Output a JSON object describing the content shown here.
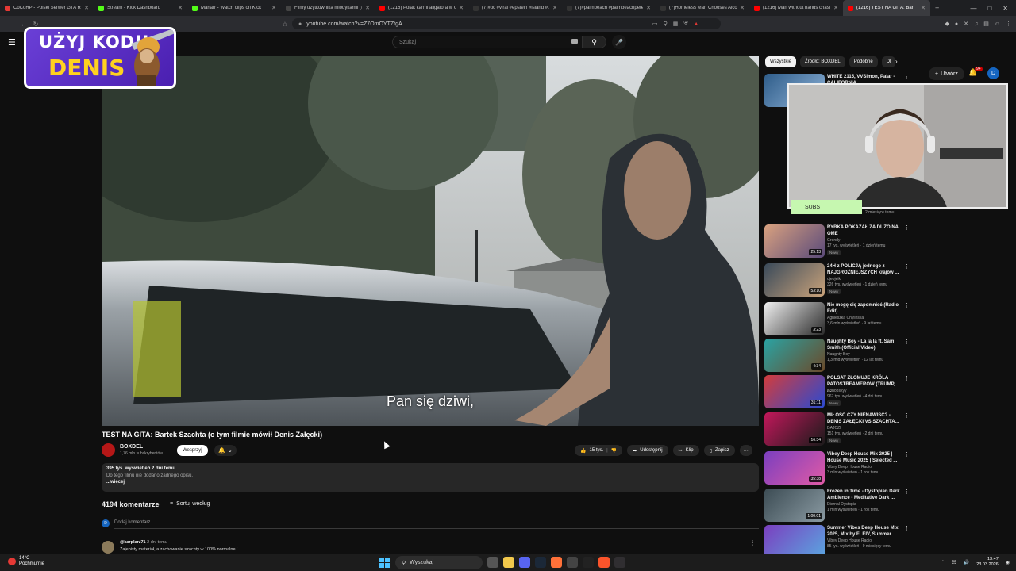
{
  "browser": {
    "tabs": [
      {
        "label": "CoCoRP - Polski Serwer GTA RP W",
        "color": "#e53935"
      },
      {
        "label": "Stream - Kick Dashboard",
        "color": "#53fc18"
      },
      {
        "label": "Maharr - Watch clips on Kick",
        "color": "#53fc18"
      },
      {
        "label": "Filmy użytkownika mlodykamil (@",
        "color": "#444444"
      },
      {
        "label": "(1216) Polak karmi aligatora w USA",
        "color": "#ff0000"
      },
      {
        "label": "(7)#dc #viral #epstein #island #tre",
        "color": "#333333"
      },
      {
        "label": "(7)#palmbeach #palmbeachpete #",
        "color": "#333333"
      },
      {
        "label": "(7)Homeless Man Chooses Alcoh",
        "color": "#333333"
      },
      {
        "label": "(1216) Man without hands chasing",
        "color": "#ff0000"
      },
      {
        "label": "(1216) TEST NA GITA: Bart",
        "color": "#ff0000"
      }
    ],
    "url": "youtube.com/watch?v=Z7OmOYTZtgA",
    "new_tab": "+"
  },
  "youtube": {
    "search_placeholder": "Szukaj",
    "create_label": "Utwórz",
    "bell_badge": "9+",
    "avatar_letter": "D"
  },
  "promo": {
    "line1": "UŻYJ KODU",
    "line2": "DENIS"
  },
  "video": {
    "subtitle": "Pan się dziwi,",
    "title": "TEST NA GITA: Bartek Szachta (o tym filmie mówił Denis Załęcki)",
    "channel": "BOXDEL",
    "subscribers": "1,76 mln subskrybentów",
    "join_label": "Wesprzyj",
    "likes": "15 tys.",
    "share_label": "Udostępnij",
    "clip_label": "Klip",
    "save_label": "Zapisz",
    "views_date": "395 tys. wyświetleń  2 dni temu",
    "desc_none": "Do tego filmu nie dodano żadnego opisu.",
    "more_label": "...więcej"
  },
  "comments": {
    "count": "4194 komentarze",
    "sort_label": "Sortuj według",
    "add_label": "Dodaj komentarz",
    "avatar_letter": "D",
    "first": {
      "user": "@karplarz71",
      "time": "2 dni temu",
      "text": "Zajebisty materiał, a zachowanie szachty w 100% normalne !"
    }
  },
  "sidebar": {
    "chips": [
      "Wszystkie",
      "Źródło: BOXDEL",
      "Podobne",
      "Dl"
    ],
    "recommendations": [
      {
        "title": "WHITE 2115, VVSimon, Palar - CALIFORNIA",
        "channel": "",
        "meta": "",
        "badge": "",
        "duration": ""
      },
      {
        "title": "RYBKA POKAZAŁ ZA DUŻO NA OME",
        "channel": "Grendy",
        "meta": "17 tys. wyświetleń · 1 dzień temu",
        "badge": "Nowy",
        "duration": "25:13"
      },
      {
        "title": "24H z POLICJĄ jednego z NAJGROŹNIEJSZYCH krajów ...",
        "channel": "ojeojeik",
        "meta": "326 tys. wyświetleń · 1 dzień temu",
        "badge": "Nowy",
        "duration": "53:10"
      },
      {
        "title": "Nie mogę cię zapomnieć (Radio Edit)",
        "channel": "Agnieszka Chylińska",
        "meta": "3,6 mln wyświetleń · 9 lat temu",
        "badge": "",
        "duration": "3:23"
      },
      {
        "title": "Naughty Boy - La la la ft. Sam Smith (Official Video)",
        "channel": "Naughty Boy",
        "meta": "1,3 mld wyświetleń · 12 lat temu",
        "badge": "",
        "duration": "4:34"
      },
      {
        "title": "POLSAT ZŁOMUJE KRÓLA PATOSTREAMERÓW (TRUMP, ...",
        "channel": "Konopskyy",
        "meta": "967 tys. wyświetleń · 4 dni temu",
        "badge": "Nowy",
        "duration": "31:11"
      },
      {
        "title": "MIŁOŚĆ CZY NIENAWIŚĆ? - DENIS ZAŁĘCKI VS SZACHTA...",
        "channel": "DAJCZI",
        "meta": "151 tys. wyświetleń · 2 dni temu",
        "badge": "Nowy",
        "duration": "16:34"
      },
      {
        "title": "Vibey Deep House Mix 2025 | House Music 2025 | Selected ...",
        "channel": "Vibey Deep House Radio",
        "meta": "3 mln wyświetleń · 1 rok temu",
        "badge": "",
        "duration": "35:38"
      },
      {
        "title": "Frozen in Time - Dystopian Dark Ambience - Meditative Dark ...",
        "channel": "Eternal Dystopia",
        "meta": "1 mln wyświetleń · 1 rok temu",
        "badge": "",
        "duration": "1:00:01"
      },
      {
        "title": "Summer Vibes Deep House Mix 2025, Mix by FLEIV, Summer ...",
        "channel": "Vibey Deep House Radio",
        "meta": "85 tys. wyświetleń · 9 miesięcy temu",
        "badge": "",
        "duration": ""
      }
    ]
  },
  "overlay": {
    "subs_label": "SUBS",
    "hidden_meta": "2 miesiące temu"
  },
  "taskbar": {
    "temp": "14°C",
    "weather": "Pochmurnie",
    "search": "Wyszukaj",
    "time": "13:47",
    "date": "23.03.2026"
  }
}
